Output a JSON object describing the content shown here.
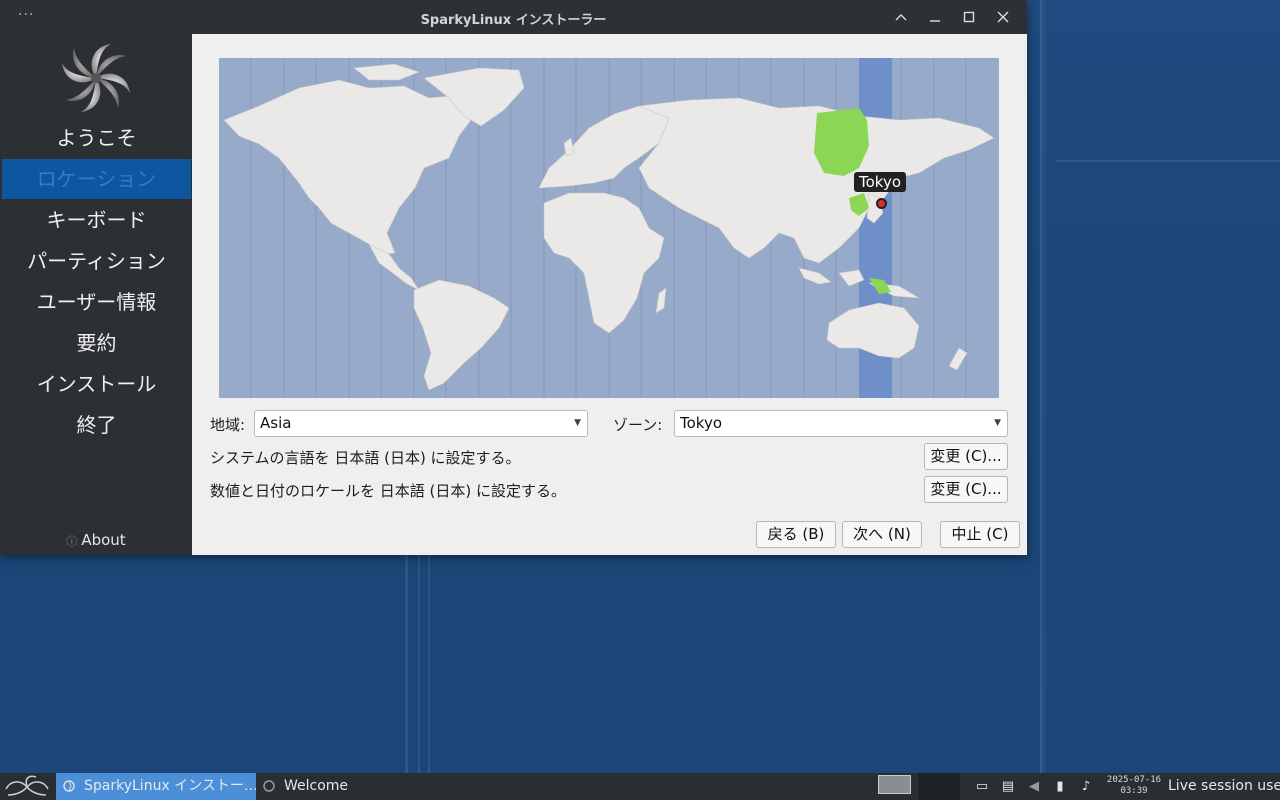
{
  "window": {
    "title": "SparkyLinux インストーラー",
    "menu": "···"
  },
  "sidebar": {
    "steps": [
      "ようこそ",
      "ロケーション",
      "キーボード",
      "パーティション",
      "ユーザー情報",
      "要約",
      "インストール",
      "終了"
    ],
    "active_step": "ロケーション",
    "about": "About"
  },
  "map": {
    "selected_city": "Tokyo",
    "highlight_color": "#8cd656",
    "tz_band_color": "#6f8fc9"
  },
  "location": {
    "region_label": "地域:",
    "region_value": "Asia",
    "zone_label": "ゾーン:",
    "zone_value": "Tokyo",
    "language_text": "システムの言語を 日本語 (日本) に設定する。",
    "locale_text": "数値と日付のロケールを 日本語 (日本) に設定する。",
    "change_button": "変更 (C)..."
  },
  "footer": {
    "back": "戻る (B)",
    "next": "次へ (N)",
    "cancel": "中止 (C)"
  },
  "taskbar": {
    "tasks": [
      "SparkyLinux インストー…",
      "Welcome"
    ],
    "clock_date": "2025-07-16",
    "clock_time": "03:39",
    "user": "Live session user"
  }
}
